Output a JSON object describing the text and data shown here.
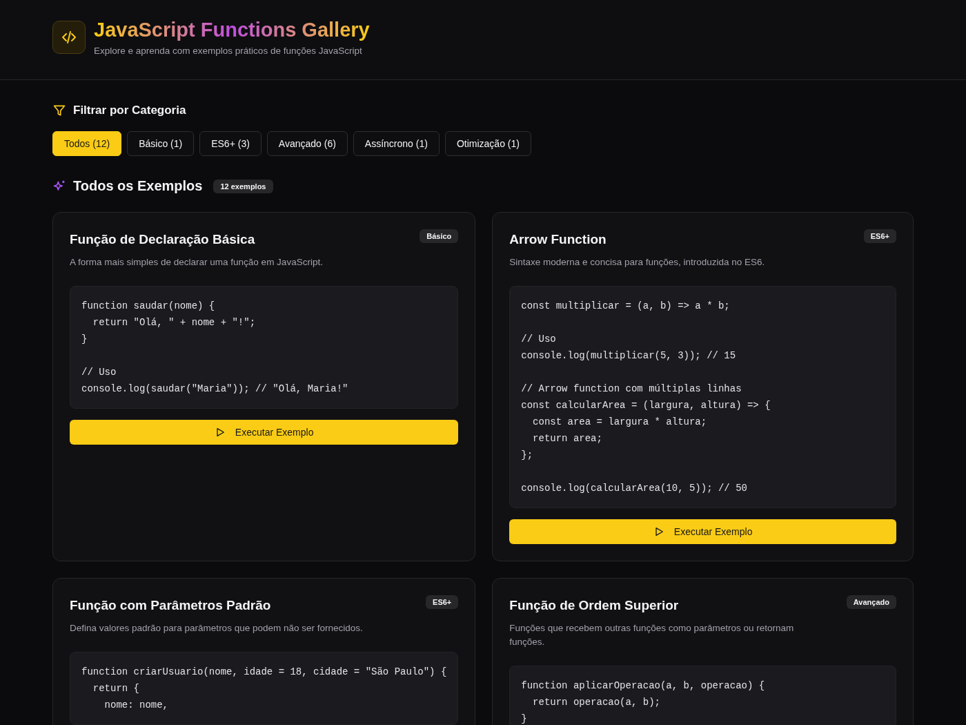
{
  "header": {
    "title": "JavaScript Functions Gallery",
    "subtitle": "Explore e aprenda com exemplos práticos de funções JavaScript"
  },
  "filter": {
    "heading": "Filtrar por Categoria",
    "categories": [
      {
        "label": "Todos (12)",
        "selected": true
      },
      {
        "label": "Básico (1)",
        "selected": false
      },
      {
        "label": "ES6+ (3)",
        "selected": false
      },
      {
        "label": "Avançado (6)",
        "selected": false
      },
      {
        "label": "Assíncrono (1)",
        "selected": false
      },
      {
        "label": "Otimização (1)",
        "selected": false
      }
    ]
  },
  "section": {
    "heading": "Todos os Exemplos",
    "count": "12 exemplos"
  },
  "examples": [
    {
      "title": "Função de Declaração Básica",
      "tag": "Básico",
      "description": "A forma mais simples de declarar uma função em JavaScript.",
      "code": "function saudar(nome) {\n  return \"Olá, \" + nome + \"!\";\n}\n\n// Uso\nconsole.log(saudar(\"Maria\")); // \"Olá, Maria!\"",
      "button": "Executar Exemplo"
    },
    {
      "title": "Arrow Function",
      "tag": "ES6+",
      "description": "Sintaxe moderna e concisa para funções, introduzida no ES6.",
      "code": "const multiplicar = (a, b) => a * b;\n\n// Uso\nconsole.log(multiplicar(5, 3)); // 15\n\n// Arrow function com múltiplas linhas\nconst calcularArea = (largura, altura) => {\n  const area = largura * altura;\n  return area;\n};\n\nconsole.log(calcularArea(10, 5)); // 50",
      "button": "Executar Exemplo"
    },
    {
      "title": "Função com Parâmetros Padrão",
      "tag": "ES6+",
      "description": "Defina valores padrão para parâmetros que podem não ser fornecidos.",
      "code": "function criarUsuario(nome, idade = 18, cidade = \"São Paulo\") {\n  return {\n    nome: nome,"
    },
    {
      "title": "Função de Ordem Superior",
      "tag": "Avançado",
      "description": "Funções que recebem outras funções como parâmetros ou retornam funções.",
      "code": "function aplicarOperacao(a, b, operacao) {\n  return operacao(a, b);\n}"
    }
  ]
}
